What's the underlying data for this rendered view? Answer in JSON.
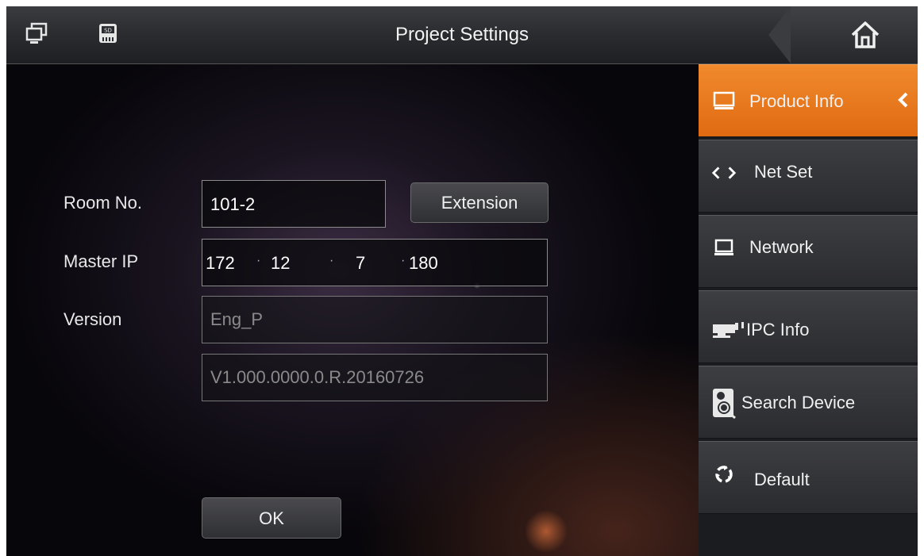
{
  "header": {
    "title": "Project Settings",
    "left_icons": [
      "monitor-icon",
      "sd-card-icon"
    ],
    "home_icon": "home-icon"
  },
  "form": {
    "room_no": {
      "label": "Room No.",
      "value": "101-2"
    },
    "extension_button": "Extension",
    "master_ip": {
      "label": "Master IP",
      "octets": [
        "172",
        "12",
        "7",
        "180"
      ],
      "separator": "·"
    },
    "version": {
      "label": "Version",
      "values": [
        "Eng_P",
        "V1.000.0000.0.R.20160726"
      ]
    },
    "ok_button": "OK"
  },
  "sidebar": {
    "items": [
      {
        "label": "Product Info",
        "icon": "monitor-icon",
        "active": true
      },
      {
        "label": "Net Set",
        "icon": "code-arrows-icon",
        "active": false
      },
      {
        "label": "Network",
        "icon": "network-monitor-icon",
        "active": false
      },
      {
        "label": "IPC Info",
        "icon": "camera-icon",
        "active": false
      },
      {
        "label": "Search Device",
        "icon": "search-device-icon",
        "active": false
      },
      {
        "label": "Default",
        "icon": "recycle-icon",
        "active": false
      }
    ]
  },
  "colors": {
    "accent": "#ee7f22",
    "header_bg": "#2b2d31",
    "sidebar_bg": "#2f3034",
    "text": "#f0f0f0",
    "disabled_text": "#8a8a8a"
  }
}
